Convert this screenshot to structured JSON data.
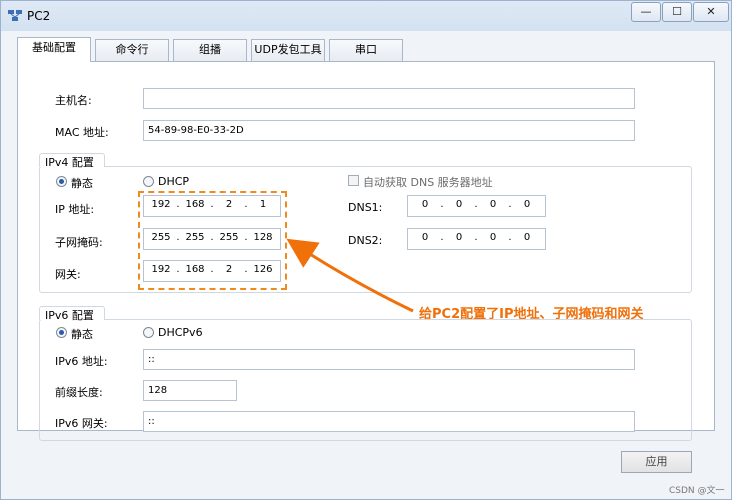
{
  "window": {
    "title": "PC2",
    "controls": {
      "minimize": "—",
      "maximize": "☐",
      "close": "✕"
    }
  },
  "tabs": [
    {
      "label": "基础配置",
      "active": true
    },
    {
      "label": "命令行",
      "active": false
    },
    {
      "label": "组播",
      "active": false
    },
    {
      "label": "UDP发包工具",
      "active": false
    },
    {
      "label": "串口",
      "active": false
    }
  ],
  "basic": {
    "hostname_label": "主机名:",
    "hostname_value": "",
    "mac_label": "MAC 地址:",
    "mac_value": "54-89-98-E0-33-2D"
  },
  "ipv4": {
    "group_title": "IPv4 配置",
    "static_label": "静态",
    "dhcp_label": "DHCP",
    "mode": "static",
    "auto_dns_label": "自动获取 DNS 服务器地址",
    "auto_dns_checked": false,
    "ip_label": "IP 地址:",
    "ip": [
      "192",
      "168",
      "2",
      "1"
    ],
    "mask_label": "子网掩码:",
    "mask": [
      "255",
      "255",
      "255",
      "128"
    ],
    "gateway_label": "网关:",
    "gateway": [
      "192",
      "168",
      "2",
      "126"
    ],
    "dns1_label": "DNS1:",
    "dns1": [
      "0",
      "0",
      "0",
      "0"
    ],
    "dns2_label": "DNS2:",
    "dns2": [
      "0",
      "0",
      "0",
      "0"
    ]
  },
  "ipv6": {
    "group_title": "IPv6 配置",
    "static_label": "静态",
    "dhcpv6_label": "DHCPv6",
    "mode": "static",
    "address_label": "IPv6 地址:",
    "address_value": "::",
    "prefix_label": "前缀长度:",
    "prefix_value": "128",
    "gateway_label": "IPv6 网关:",
    "gateway_value": "::"
  },
  "annotation": {
    "text": "给PC2配置了IP地址、子网掩码和网关",
    "color": "#f0700a"
  },
  "apply_label": "应用",
  "watermark": "CSDN @文一"
}
